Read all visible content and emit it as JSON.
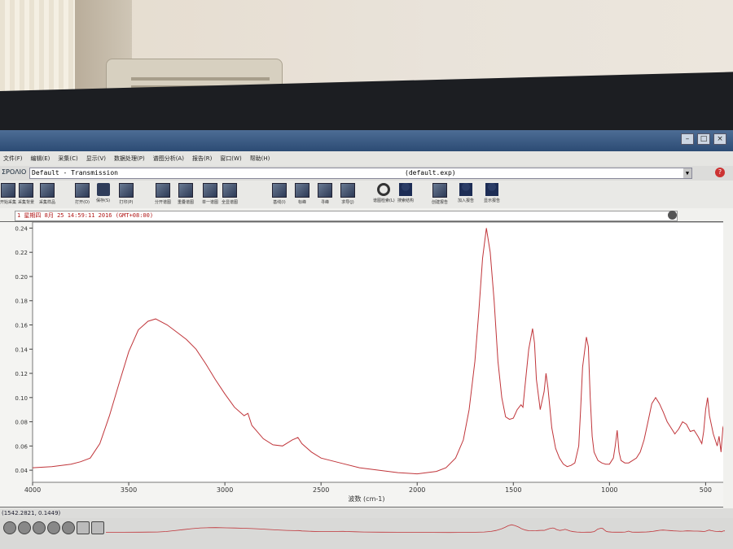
{
  "window": {
    "app_short": "ΣΡΟΛΙΟ",
    "combo_text": "Default - Transmission",
    "file_name": "(default.exp)",
    "help_icon": "?"
  },
  "menu": [
    "文件(F)",
    "编辑(E)",
    "采集(C)",
    "显示(V)",
    "数据处理(P)",
    "谱图分析(A)",
    "报告(R)",
    "窗口(W)",
    "帮助(H)"
  ],
  "toolbar": [
    "开始采集",
    "采集背景",
    "采集样品",
    "打开(O)",
    "保存(S)",
    "打印(P)",
    "分开谱图",
    "重叠谱图",
    "单一谱图",
    "全显谱图",
    "基线(I)",
    "标峰",
    "寻峰",
    "求导(J)",
    "谱图检索(L)",
    "搜索结构",
    "创建报告",
    "加入报告",
    "显示报告"
  ],
  "info_text": "1 星期四 8月 25 14:59:11 2016 (GMT+08:00)",
  "status_text": "(1542.2821, 0.1449)",
  "chart_data": {
    "type": "line",
    "xlabel": "波数 (cm-1)",
    "ylabel": "",
    "xlim": [
      4000,
      400
    ],
    "ylim": [
      0.03,
      0.245
    ],
    "x_ticks": [
      4000,
      3500,
      3000,
      2500,
      2000,
      1500,
      1000,
      500
    ],
    "y_ticks": [
      0.04,
      0.06,
      0.08,
      0.1,
      0.12,
      0.14,
      0.16,
      0.18,
      0.2,
      0.22,
      0.24
    ],
    "color": "#c0353a",
    "series": [
      {
        "x": [
          4000,
          3900,
          3800,
          3750,
          3700,
          3650,
          3600,
          3550,
          3500,
          3450,
          3400,
          3360,
          3300,
          3250,
          3200,
          3150,
          3100,
          3050,
          3000,
          2950,
          2900,
          2880,
          2860,
          2800,
          2750,
          2700,
          2650,
          2620,
          2600,
          2550,
          2500,
          2400,
          2300,
          2200,
          2100,
          2000,
          1950,
          1900,
          1850,
          1800,
          1760,
          1730,
          1700,
          1680,
          1660,
          1640,
          1620,
          1600,
          1580,
          1560,
          1540,
          1520,
          1500,
          1480,
          1460,
          1450,
          1440,
          1420,
          1400,
          1390,
          1380,
          1360,
          1340,
          1330,
          1320,
          1300,
          1280,
          1260,
          1240,
          1220,
          1200,
          1180,
          1160,
          1150,
          1140,
          1120,
          1110,
          1100,
          1090,
          1080,
          1060,
          1040,
          1020,
          1000,
          980,
          970,
          960,
          950,
          940,
          920,
          900,
          880,
          860,
          840,
          820,
          800,
          780,
          760,
          740,
          720,
          700,
          680,
          660,
          640,
          620,
          600,
          580,
          560,
          540,
          520,
          510,
          500,
          490,
          480,
          460,
          450,
          440,
          430,
          420,
          410,
          400
        ],
        "y": [
          0.042,
          0.043,
          0.045,
          0.047,
          0.05,
          0.062,
          0.085,
          0.112,
          0.138,
          0.156,
          0.163,
          0.165,
          0.16,
          0.154,
          0.148,
          0.14,
          0.128,
          0.115,
          0.103,
          0.092,
          0.085,
          0.087,
          0.077,
          0.066,
          0.061,
          0.06,
          0.065,
          0.067,
          0.062,
          0.055,
          0.05,
          0.046,
          0.042,
          0.04,
          0.038,
          0.037,
          0.038,
          0.039,
          0.042,
          0.05,
          0.065,
          0.09,
          0.13,
          0.17,
          0.215,
          0.24,
          0.22,
          0.18,
          0.13,
          0.1,
          0.084,
          0.082,
          0.083,
          0.09,
          0.094,
          0.092,
          0.108,
          0.14,
          0.157,
          0.145,
          0.115,
          0.09,
          0.105,
          0.12,
          0.108,
          0.075,
          0.058,
          0.05,
          0.045,
          0.043,
          0.044,
          0.046,
          0.06,
          0.09,
          0.125,
          0.15,
          0.142,
          0.1,
          0.068,
          0.055,
          0.048,
          0.046,
          0.045,
          0.045,
          0.05,
          0.06,
          0.073,
          0.055,
          0.048,
          0.046,
          0.046,
          0.048,
          0.05,
          0.055,
          0.065,
          0.08,
          0.095,
          0.1,
          0.095,
          0.088,
          0.08,
          0.075,
          0.07,
          0.074,
          0.08,
          0.078,
          0.072,
          0.073,
          0.068,
          0.062,
          0.072,
          0.09,
          0.1,
          0.085,
          0.07,
          0.065,
          0.06,
          0.068,
          0.055,
          0.075,
          0.08
        ]
      }
    ]
  }
}
